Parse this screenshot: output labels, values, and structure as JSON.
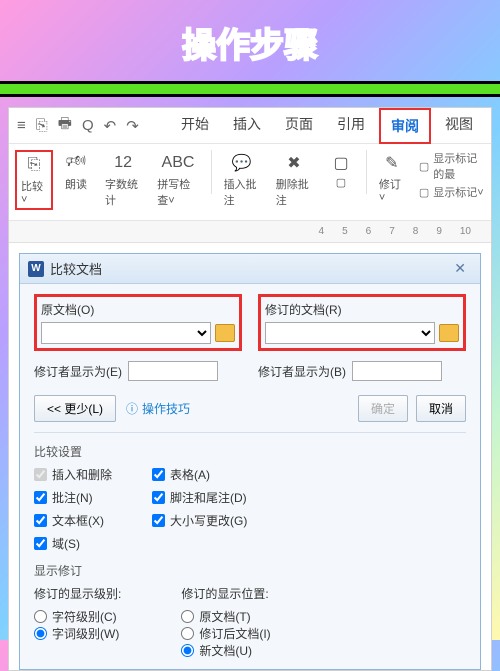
{
  "title": "操作步骤",
  "menu_icons": [
    "≡",
    "⎘",
    "🖶",
    "Q",
    "↶",
    "↷"
  ],
  "tabs": [
    {
      "label": "开始"
    },
    {
      "label": "插入"
    },
    {
      "label": "页面"
    },
    {
      "label": "引用"
    },
    {
      "label": "审阅",
      "active": true
    },
    {
      "label": "视图"
    }
  ],
  "ribbon": {
    "compare": "比较˅",
    "read": "朗读",
    "count": "字数统计",
    "spell": "拼写检查˅",
    "insert_comment": "插入批注",
    "delete_comment": "删除批注",
    "nav": "▢",
    "track": "修订˅",
    "show_markup_title": "显示标记的最",
    "show_markup": "显示标记˅"
  },
  "ruler": [
    "4",
    "5",
    "6",
    "7",
    "8",
    "9",
    "10"
  ],
  "dialog": {
    "title": "比较文档",
    "original": {
      "label": "原文档(O)"
    },
    "revised": {
      "label": "修订的文档(R)"
    },
    "author_l": "修订者显示为(E)",
    "author_r": "修订者显示为(B)",
    "less": "<< 更少(L)",
    "tip": "操作技巧",
    "ok": "确定",
    "cancel": "取消",
    "settings_title": "比较设置",
    "settings_left": [
      {
        "label": "插入和删除",
        "checked": true,
        "disabled": true
      },
      {
        "label": "批注(N)",
        "checked": true
      },
      {
        "label": "文本框(X)",
        "checked": true
      },
      {
        "label": "域(S)",
        "checked": true
      }
    ],
    "settings_right": [
      {
        "label": "表格(A)",
        "checked": true
      },
      {
        "label": "脚注和尾注(D)",
        "checked": true
      },
      {
        "label": "大小写更改(G)",
        "checked": true
      }
    ],
    "show_title": "显示修订",
    "level_title": "修订的显示级别:",
    "level": [
      {
        "label": "字符级别(C)",
        "sel": false
      },
      {
        "label": "字词级别(W)",
        "sel": true
      }
    ],
    "pos_title": "修订的显示位置:",
    "pos": [
      {
        "label": "原文档(T)",
        "sel": false
      },
      {
        "label": "修订后文档(I)",
        "sel": false
      },
      {
        "label": "新文档(U)",
        "sel": true
      }
    ]
  }
}
